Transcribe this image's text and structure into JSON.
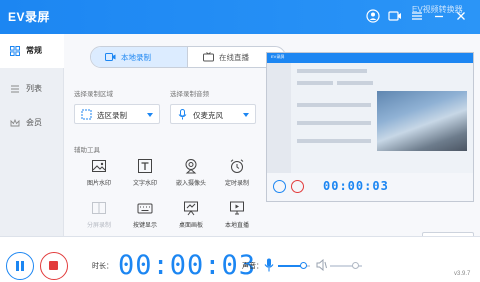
{
  "app": {
    "title": "EV录屏",
    "watermark": "EV视频转换器",
    "accent": "#1c86f2",
    "danger": "#e23b3b"
  },
  "titlebar": {
    "icons": [
      "user-icon",
      "video-icon",
      "menu-icon",
      "minimize-icon",
      "close-icon"
    ]
  },
  "sidebar": {
    "items": [
      {
        "label": "常规",
        "icon": "grid-icon",
        "active": true
      },
      {
        "label": "列表",
        "icon": "list-icon",
        "active": false
      },
      {
        "label": "会员",
        "icon": "crown-icon",
        "active": false
      }
    ]
  },
  "mode_tabs": [
    {
      "label": "本地录制",
      "icon": "video-camera-icon",
      "active": true
    },
    {
      "label": "在线直播",
      "icon": "live-tv-icon",
      "active": false
    }
  ],
  "region": {
    "label": "选择录制区域",
    "value": "选区录制"
  },
  "audio": {
    "label": "选择录制音频",
    "value": "仅麦克风"
  },
  "tools": {
    "label": "辅助工具",
    "items": [
      {
        "label": "图片水印",
        "icon": "image-icon",
        "disabled": false
      },
      {
        "label": "文字水印",
        "icon": "text-icon",
        "disabled": false
      },
      {
        "label": "嵌入摄像头",
        "icon": "webcam-icon",
        "disabled": false
      },
      {
        "label": "定时录制",
        "icon": "alarm-clock-icon",
        "disabled": false
      },
      {
        "label": "分屏录制",
        "icon": "split-screen-icon",
        "disabled": true
      },
      {
        "label": "按键显示",
        "icon": "keyboard-icon",
        "disabled": false
      },
      {
        "label": "桌面画板",
        "icon": "whiteboard-icon",
        "disabled": false
      },
      {
        "label": "本地直播",
        "icon": "monitor-icon",
        "disabled": false
      }
    ]
  },
  "preview": {
    "title": "EV录屏",
    "timer": "00:00:03"
  },
  "scene_button": "场景编辑",
  "controls": {
    "duration_label": "时长：",
    "timer": "00:00:03",
    "sound_label": "声音：",
    "mic_level": 0.8,
    "speaker_level": 0.8
  },
  "version": "v3.9.7"
}
